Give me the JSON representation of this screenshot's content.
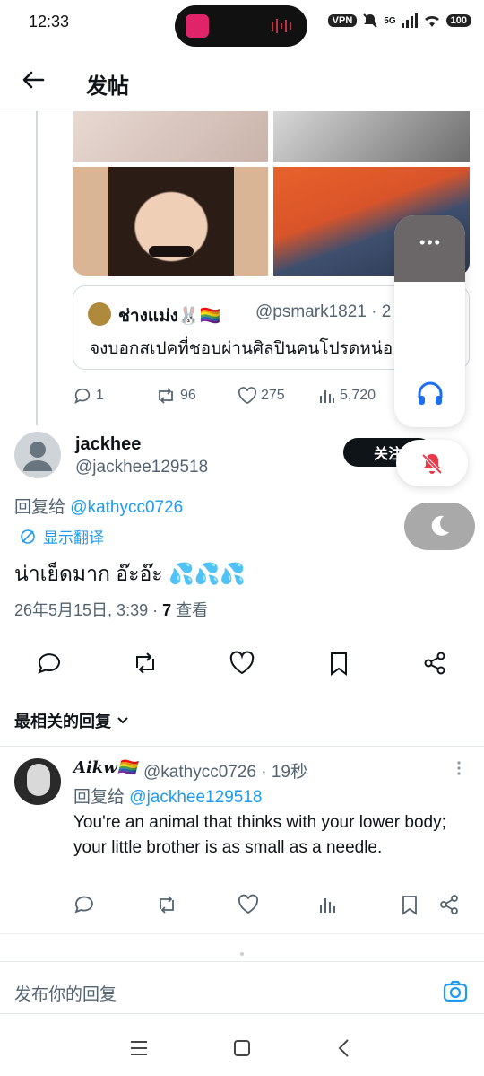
{
  "status": {
    "time": "12:33",
    "vpn": "VPN",
    "network": "5G",
    "battery": "100"
  },
  "header": {
    "title": "发帖"
  },
  "quote": {
    "name": "ช่างแม่ง🐰🏳️‍🌈",
    "handle": "@psmark1821 · 2",
    "text": "จงบอกสเปคที่ชอบผ่านศิลปินคนโปรดหน่อ"
  },
  "parent_actions": {
    "replies": "1",
    "reposts": "96",
    "likes": "275",
    "views": "5,720"
  },
  "post": {
    "name": "jackhee",
    "handle": "@jackhee129518",
    "follow_label": "关注",
    "reply_prefix": "回复给 ",
    "reply_to": "@kathycc0726",
    "translate": "显示翻译",
    "text": "น่าเย็ดมาก อ๊ะอ๊ะ 💦💦💦",
    "meta_prefix": "26年5月15日, 3:39 · ",
    "views_count": "7",
    "views_label": " 查看"
  },
  "sort": {
    "label": "最相关的回复"
  },
  "reply": {
    "name": "𝑨𝒊𝒌𝒘🏳️‍🌈",
    "handle": "@kathycc0726 · 19秒",
    "reply_prefix": "回复给 ",
    "reply_to": "@jackhee129518",
    "text": "You're an animal that thinks with your lower body; your little brother is as small as a needle."
  },
  "composer": {
    "placeholder": "发布你的回复"
  },
  "floating": {
    "dots": "•••"
  },
  "colors": {
    "accent": "#1d9bf0",
    "text": "#0f1419",
    "muted": "#536471"
  }
}
